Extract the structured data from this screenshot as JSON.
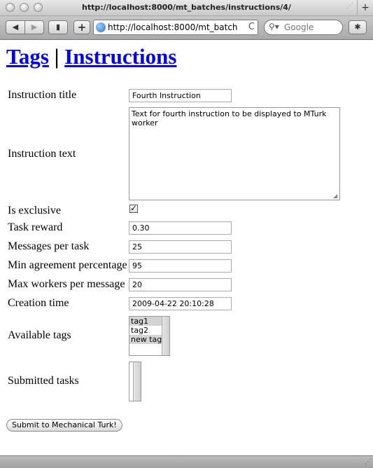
{
  "window": {
    "title": "http://localhost:8000/mt_batches/instructions/4/",
    "new_tab": "+"
  },
  "toolbar": {
    "back": "◀",
    "forward": "▶",
    "add": "+",
    "url": "http://localhost:8000/mt_batch",
    "reload": "C",
    "search_placeholder": "Google"
  },
  "header": {
    "tags_link": "Tags",
    "separator": " | ",
    "instructions_link": "Instructions"
  },
  "form": {
    "instruction_title_label": "Instruction title",
    "instruction_title_value": "Fourth Instruction",
    "instruction_text_label": "Instruction text",
    "instruction_text_value": "Text for fourth instruction to be displayed to MTurk worker",
    "is_exclusive_label": "Is exclusive",
    "is_exclusive_checked": true,
    "task_reward_label": "Task reward",
    "task_reward_value": "0.30",
    "messages_per_task_label": "Messages per task",
    "messages_per_task_value": "25",
    "min_agreement_label": "Min agreement percentage",
    "min_agreement_value": "95",
    "max_workers_label": "Max workers per message",
    "max_workers_value": "20",
    "creation_time_label": "Creation time",
    "creation_time_value": "2009-04-22 20:10:28",
    "available_tags_label": "Available tags",
    "available_tags": [
      {
        "label": "tag1",
        "selected": true
      },
      {
        "label": "tag2",
        "selected": false
      },
      {
        "label": "new tag",
        "selected": true
      }
    ],
    "submitted_tasks_label": "Submitted tasks",
    "submit_label": "Submit to Mechanical Turk!"
  },
  "colors": {
    "link": "#0000ee",
    "selected_option": "#d4d4d4"
  }
}
